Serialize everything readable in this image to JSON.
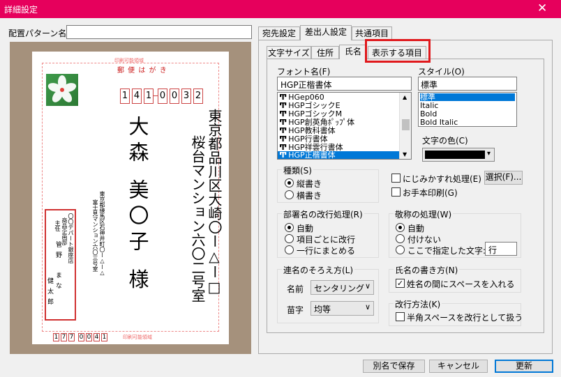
{
  "window": {
    "title": "詳細設定",
    "close": "✕"
  },
  "pattern": {
    "label": "配置パターン名",
    "value": ""
  },
  "tabs_main": [
    "宛先設定",
    "差出人設定",
    "共通項目"
  ],
  "tabs_sub": [
    "文字サイズ",
    "住所",
    "氏名",
    "表示する項目"
  ],
  "font": {
    "label": "フォント名(F)",
    "value": "HGP正楷書体",
    "items": [
      "HGep060",
      "HGPゴシックE",
      "HGPゴシックM",
      "HGP創英角ﾎﾟｯﾌﾟ体",
      "HGP教科書体",
      "HGP行書体",
      "HGP祥雲行書体",
      "HGP正楷書体"
    ],
    "icon": "Ͳ"
  },
  "style": {
    "label": "スタイル(O)",
    "value": "標準",
    "items": [
      "標準",
      "Italic",
      "Bold",
      "Bold Italic"
    ]
  },
  "color": {
    "label": "文字の色(C)",
    "value": "#000000"
  },
  "kind": {
    "label": "種類(S)",
    "options": [
      "縦書き",
      "横書き"
    ]
  },
  "blur": {
    "label": "にじみかすれ処理(E)",
    "select_label": "選択(F)..."
  },
  "sample": {
    "label": "お手本印刷(G)"
  },
  "dept": {
    "label": "部署名の改行処理(R)",
    "options": [
      "自動",
      "項目ごとに改行",
      "一行にまとめる"
    ]
  },
  "honor": {
    "label": "敬称の処理(W)",
    "options": [
      "自動",
      "付けない",
      "ここで指定した文字:"
    ],
    "custom_value": "行"
  },
  "joint": {
    "label": "連名のそろえ方(L)",
    "first_label": "名前",
    "first_value": "センタリング",
    "last_label": "苗字",
    "last_value": "均等"
  },
  "namestyle": {
    "label": "氏名の書き方(N)",
    "check_label": "姓名の間にスペースを入れる"
  },
  "wrap": {
    "label": "改行方法(K)",
    "check_label": "半角スペースを改行として扱う"
  },
  "buttons": {
    "save_as": "別名で保存",
    "cancel": "キャンセル",
    "update": "更新"
  },
  "card": {
    "header": "郵 便 は が き",
    "print_area": "印刷可能領域",
    "zip": [
      "1",
      "4",
      "1",
      "0",
      "0",
      "3",
      "2"
    ],
    "address1": "東京都品川区大崎〇ー△ー□",
    "address2": "桜台マンション六〇二号室",
    "name": "大森 美〇子 様",
    "sender_address": "東京都練馬区石神井町〇ー△ー△",
    "sender_building": "富士見マンション六〇三号室",
    "sender_company": "〇〇デパート銀座店",
    "sender_dept": "商品企画部",
    "sender_title": "主任",
    "sender_last": "管野",
    "sender_first1": "まな",
    "sender_first2": "健太郎",
    "sender_zip": [
      "1",
      "7",
      "7",
      "0",
      "0",
      "4",
      "1"
    ]
  },
  "colors": {
    "title_bar": "#e6005c",
    "highlight": "#e0181c",
    "selection": "#0078d7",
    "preview_bg": "#a5917c",
    "postal_red": "#cc2222"
  }
}
